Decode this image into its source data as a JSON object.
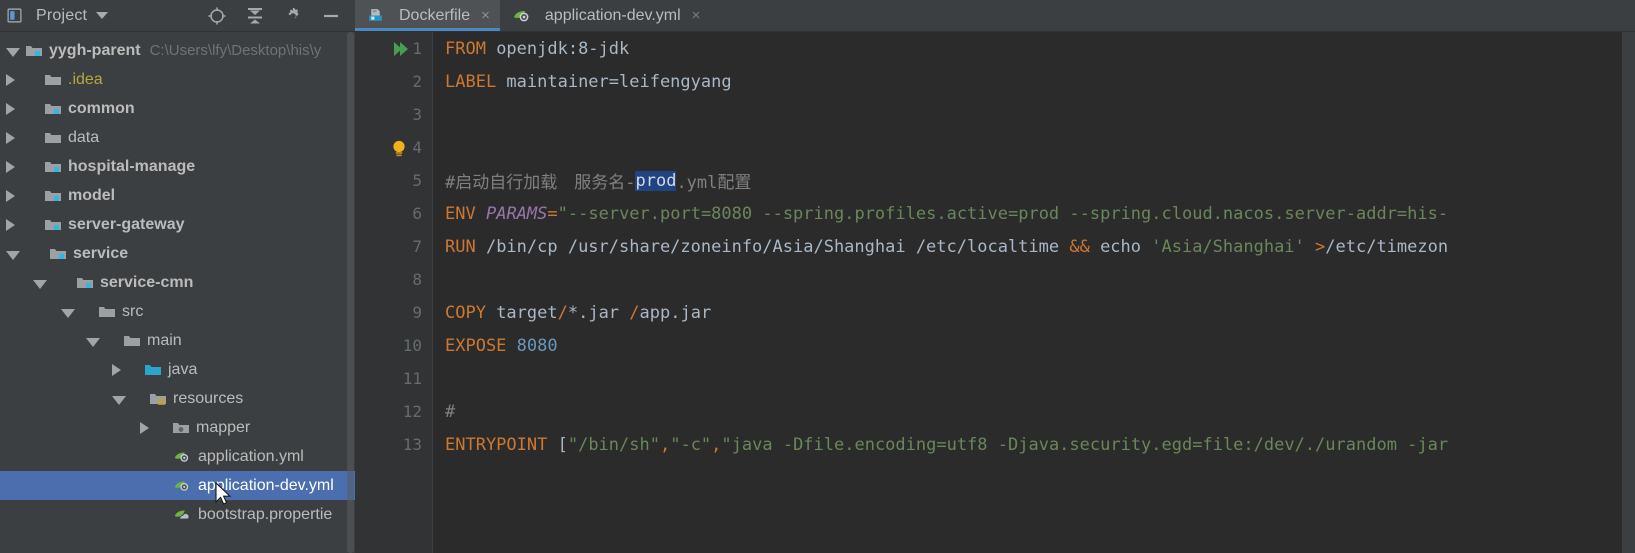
{
  "project_panel": {
    "title": "Project",
    "dropdown_icon": "chevron-down-icon",
    "toolbar": [
      {
        "name": "locate-icon",
        "tooltip": "Select Opened File"
      },
      {
        "name": "collapse-all-icon",
        "tooltip": "Collapse All"
      },
      {
        "name": "gear-icon",
        "tooltip": "Settings"
      },
      {
        "name": "minimize-icon",
        "tooltip": "Hide"
      }
    ]
  },
  "tabs": [
    {
      "label": "Dockerfile",
      "icon": "docker-file-icon",
      "active": true,
      "close_glyph": "×"
    },
    {
      "label": "application-dev.yml",
      "icon": "spring-yaml-icon",
      "active": false,
      "close_glyph": "×"
    }
  ],
  "tree": [
    {
      "label": "yygh-parent",
      "path": "C:\\Users\\lfy\\Desktop\\his\\y",
      "indent": 0,
      "arrow": "open",
      "icon": "module-folder-icon",
      "bold": true,
      "selected": false
    },
    {
      "label": ".idea",
      "indent": 1,
      "arrow": "closed",
      "icon": "folder-icon",
      "excluded": true,
      "selected": false
    },
    {
      "label": "common",
      "indent": 1,
      "arrow": "closed",
      "icon": "module-folder-icon",
      "bold": true,
      "selected": false
    },
    {
      "label": "data",
      "indent": 1,
      "arrow": "closed",
      "icon": "folder-icon",
      "selected": false
    },
    {
      "label": "hospital-manage",
      "indent": 1,
      "arrow": "closed",
      "icon": "module-folder-icon",
      "bold": true,
      "selected": false
    },
    {
      "label": "model",
      "indent": 1,
      "arrow": "closed",
      "icon": "module-folder-icon",
      "bold": true,
      "selected": false
    },
    {
      "label": "server-gateway",
      "indent": 1,
      "arrow": "closed",
      "icon": "module-folder-icon",
      "bold": true,
      "selected": false
    },
    {
      "label": "service",
      "indent": 1,
      "arrow": "open",
      "icon": "module-folder-icon",
      "bold": true,
      "selected": false
    },
    {
      "label": "service-cmn",
      "indent": 2,
      "arrow": "open",
      "icon": "module-folder-icon",
      "bold": true,
      "selected": false
    },
    {
      "label": "src",
      "indent": 3,
      "arrow": "open",
      "icon": "folder-icon",
      "selected": false
    },
    {
      "label": "main",
      "indent": 4,
      "arrow": "open",
      "icon": "folder-icon",
      "selected": false
    },
    {
      "label": "java",
      "indent": 5,
      "arrow": "closed",
      "icon": "source-root-folder-icon",
      "selected": false
    },
    {
      "label": "resources",
      "indent": 5,
      "arrow": "open",
      "icon": "resources-root-folder-icon",
      "selected": false
    },
    {
      "label": "mapper",
      "indent": 6,
      "arrow": "closed",
      "icon": "package-folder-icon",
      "selected": false
    },
    {
      "label": "application.yml",
      "indent": 6,
      "arrow": "none",
      "icon": "spring-yaml-icon",
      "selected": false
    },
    {
      "label": "application-dev.yml",
      "indent": 6,
      "arrow": "none",
      "icon": "spring-yaml-icon",
      "selected": true
    },
    {
      "label": "bootstrap.propertie",
      "indent": 6,
      "arrow": "none",
      "icon": "spring-properties-icon",
      "selected": false
    }
  ],
  "editor": {
    "line_numbers": [
      "1",
      "2",
      "3",
      "4",
      "5",
      "6",
      "7",
      "8",
      "9",
      "10",
      "11",
      "12",
      "13"
    ],
    "gutter_marks": [
      {
        "line": 1,
        "icon": "run-double-arrow-icon",
        "color": "#499c54"
      },
      {
        "line": 4,
        "icon": "lightbulb-intention-icon",
        "color": "#f0b11b"
      }
    ],
    "selection_text": "prod",
    "lines": {
      "l1_kw": "FROM",
      "l1_val": " openjdk:8-jdk",
      "l2_kw": "LABEL",
      "l2_val": " maintainer=leifengyang",
      "l5_cmt_a": "#启动自行加载　服务名-",
      "l5_sel": "prod",
      "l5_cmt_b": ".yml配置",
      "l6_kw": "ENV",
      "l6_var": "PARAMS",
      "l6_eq": "=",
      "l6_quote": "\"",
      "l6_val": "--server.port=8080 --spring.profiles.active=prod --spring.cloud.nacos.server-addr=his-",
      "l7_kw": "RUN",
      "l7_a": " /bin/cp /usr/share/zoneinfo/Asia/Shanghai /etc/localtime ",
      "l7_op": "&&",
      "l7_b": " echo ",
      "l7_str": "'Asia/Shanghai'",
      "l7_gt": " >",
      "l7_c": "/etc/timezon",
      "l9_kw": "COPY",
      "l9_a": " target",
      "l9_slash1": "/",
      "l9_b": "*.jar ",
      "l9_slash2": "/",
      "l9_c": "app.jar",
      "l10_kw": "EXPOSE",
      "l10_num": " 8080",
      "l12_cmt": "#",
      "l13_kw": "ENTRYPOINT",
      "l13_br": " [",
      "l13_s1": "\"/bin/sh\"",
      "l13_c1": ",",
      "l13_s2": "\"-c\"",
      "l13_c2": ",",
      "l13_s3": "\"java -Dfile.encoding=utf8 -Djava.security.egd=file:/dev/./urandom -jar"
    }
  },
  "colors": {
    "panel_bg": "#3c3f41",
    "editor_bg": "#2b2b2b",
    "gutter_bg": "#313335",
    "selection_row": "#4b6eaf",
    "text_selection": "#214283",
    "keyword": "#cc7832",
    "string": "#6a8759",
    "number": "#6897bb",
    "comment": "#808080",
    "variable": "#9876aa",
    "tab_active": "#4e5254",
    "tab_underline": "#4a88c7"
  }
}
